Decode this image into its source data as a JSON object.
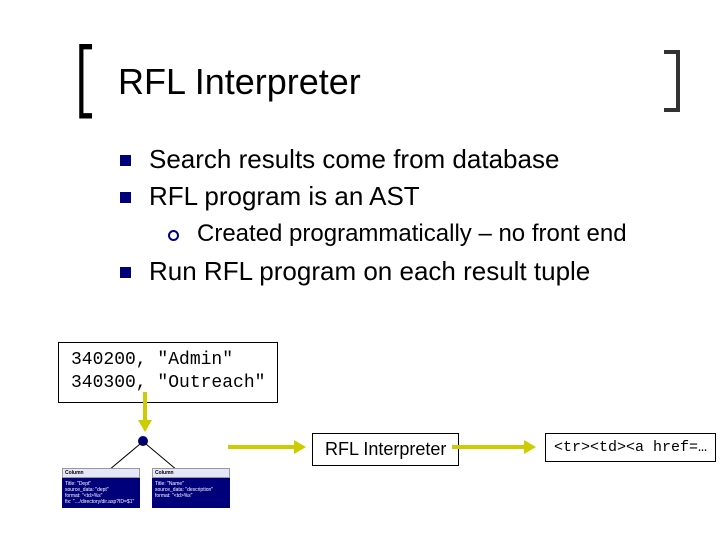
{
  "title": "RFL Interpreter",
  "bullets": {
    "b1": "Search results come from database",
    "b2": "RFL program is an AST",
    "b2_sub": "Created programmatically – no front end",
    "b3": "Run RFL program on each result tuple"
  },
  "tuples": {
    "row1": "340200, \"Admin\"",
    "row2": "340300, \"Outreach\""
  },
  "interp_label": "RFL Interpreter",
  "output_code": "<tr><td><a href=…",
  "tree": {
    "node_header": "Column",
    "node1_body": "Title: \"Dept\"\nsource_data: \"dept\"\nformat: \"<td>%s\"\nfix: \"…/directory/dir.asp?ID=$1\"",
    "node2_body": "Title: \"Name\"\nsource_data: \"description\"\nformat: \"<td>%s\""
  }
}
